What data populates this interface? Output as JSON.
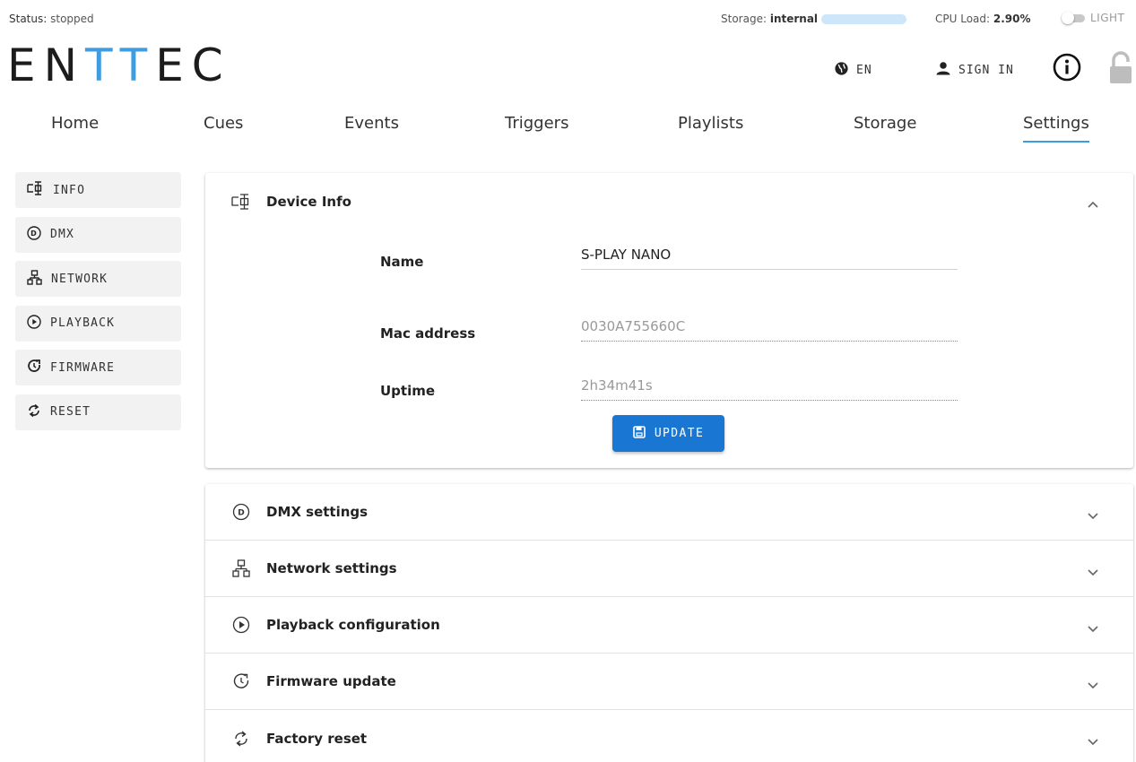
{
  "status": {
    "label": "Status:",
    "value": "stopped"
  },
  "storage": {
    "label": "Storage:",
    "value": "internal"
  },
  "cpu": {
    "label": "CPU Load:",
    "value": "2.90%"
  },
  "theme": {
    "label": "LIGHT"
  },
  "logo": {
    "part1": "EN",
    "part2": "TT",
    "part3": "EC"
  },
  "header": {
    "language": "EN",
    "sign_in": "SIGN IN"
  },
  "nav": {
    "tabs": [
      {
        "label": "Home"
      },
      {
        "label": "Cues"
      },
      {
        "label": "Events"
      },
      {
        "label": "Triggers"
      },
      {
        "label": "Playlists"
      },
      {
        "label": "Storage"
      },
      {
        "label": "Settings"
      }
    ]
  },
  "sidebar": {
    "items": [
      {
        "label": "INFO",
        "icon": "device-icon"
      },
      {
        "label": "DMX",
        "icon": "dmx-icon"
      },
      {
        "label": "NETWORK",
        "icon": "network-icon"
      },
      {
        "label": "PLAYBACK",
        "icon": "play-icon"
      },
      {
        "label": "FIRMWARE",
        "icon": "firmware-icon"
      },
      {
        "label": "RESET",
        "icon": "reset-icon"
      }
    ]
  },
  "device_info": {
    "title": "Device Info",
    "fields": [
      {
        "label": "Name",
        "value": "S-PLAY NANO"
      },
      {
        "label": "Mac address",
        "value": "0030A755660C"
      },
      {
        "label": "Uptime",
        "value": "2h34m41s"
      }
    ],
    "update_label": "UPDATE"
  },
  "sections": [
    {
      "title": "DMX settings"
    },
    {
      "title": "Network settings"
    },
    {
      "title": "Playback configuration"
    },
    {
      "title": "Firmware update"
    },
    {
      "title": "Factory reset"
    }
  ],
  "colors": {
    "accent": "#3d9de0",
    "button": "#1976d2"
  }
}
